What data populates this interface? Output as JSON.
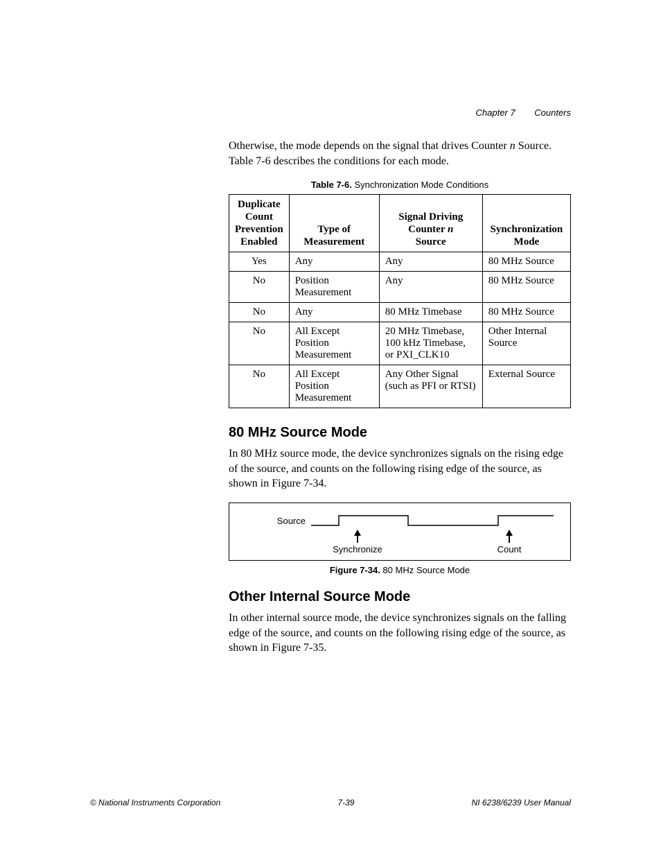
{
  "header": {
    "chapter": "Chapter 7",
    "title": "Counters"
  },
  "intro_para_pre": "Otherwise, the mode depends on the signal that drives Counter ",
  "intro_counter_var": "n",
  "intro_para_post": " Source. Table 7-6 describes the conditions for each mode.",
  "table_caption_bold": "Table 7-6.",
  "table_caption_rest": "  Synchronization Mode Conditions",
  "th": {
    "col1_l1": "Duplicate",
    "col1_l2": "Count",
    "col1_l3": "Prevention",
    "col1_l4": "Enabled",
    "col2_l1": "Type of",
    "col2_l2": "Measurement",
    "col3_l1": "Signal Driving",
    "col3_l2a": "Counter ",
    "col3_l2b": "n",
    "col3_l3": "Source",
    "col4_l1": "Synchronization",
    "col4_l2": "Mode"
  },
  "rows": [
    {
      "c1": "Yes",
      "c2": "Any",
      "c3": "Any",
      "c4": "80 MHz Source"
    },
    {
      "c1": "No",
      "c2": "Position Measurement",
      "c3": "Any",
      "c4": "80 MHz Source"
    },
    {
      "c1": "No",
      "c2": "Any",
      "c3": "80 MHz Timebase",
      "c4": "80 MHz Source"
    },
    {
      "c1": "No",
      "c2": "All Except Position Measurement",
      "c3": "20 MHz Timebase, 100 kHz Timebase, or PXI_CLK10",
      "c4": "Other Internal Source"
    },
    {
      "c1": "No",
      "c2": "All Except Position Measurement",
      "c3": "Any Other Signal (such as PFI or RTSI)",
      "c4": "External Source"
    }
  ],
  "section1_heading": "80 MHz Source Mode",
  "section1_para": "In 80 MHz source mode, the device synchronizes signals on the rising edge of the source, and counts on the following rising edge of the source, as shown in Figure 7-34.",
  "figure": {
    "source_label": "Source",
    "sync_label": "Synchronize",
    "count_label": "Count"
  },
  "figure_caption_bold": "Figure 7-34.",
  "figure_caption_rest": "  80 MHz Source Mode",
  "section2_heading": "Other Internal Source Mode",
  "section2_para": "In other internal source mode, the device synchronizes signals on the falling edge of the source, and counts on the following rising edge of the source, as shown in Figure 7-35.",
  "footer": {
    "left": "© National Instruments Corporation",
    "center": "7-39",
    "right": "NI 6238/6239 User Manual"
  }
}
